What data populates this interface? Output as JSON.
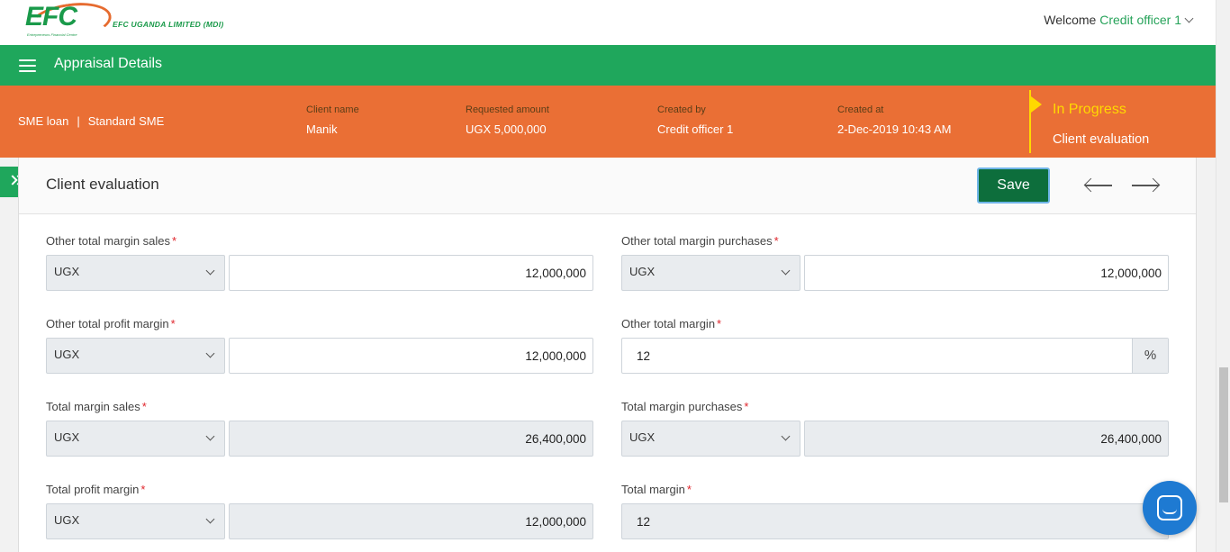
{
  "header": {
    "logo_text": "EFC",
    "logo_tagline": "Entrepreneurs Financial Centre",
    "company": "EFC UGANDA LIMITED (MDI)",
    "welcome_prefix": "Welcome",
    "user": "Credit officer 1"
  },
  "nav": {
    "title": "Appraisal Details"
  },
  "summary": {
    "loan_type": "SME loan",
    "separator": "|",
    "loan_subtype": "Standard SME",
    "client_name_label": "Client name",
    "client_name": "Manik",
    "requested_amount_label": "Requested amount",
    "requested_amount": "UGX 5,000,000",
    "created_by_label": "Created by",
    "created_by": "Credit officer 1",
    "created_at_label": "Created at",
    "created_at": "2-Dec-2019 10:43 AM",
    "status": "In Progress",
    "stage": "Client evaluation"
  },
  "section": {
    "title": "Client evaluation",
    "save_label": "Save"
  },
  "form": {
    "required_marker": "*",
    "other_total_margin_sales": {
      "label": "Other total margin sales",
      "currency": "UGX",
      "value": "12,000,000"
    },
    "other_total_margin_purchases": {
      "label": "Other total margin purchases",
      "currency": "UGX",
      "value": "12,000,000"
    },
    "other_total_profit_margin": {
      "label": "Other total profit margin",
      "currency": "UGX",
      "value": "12,000,000"
    },
    "other_total_margin": {
      "label": "Other total margin",
      "value": "12",
      "unit": "%"
    },
    "total_margin_sales": {
      "label": "Total margin sales",
      "currency": "UGX",
      "value": "26,400,000"
    },
    "total_margin_purchases": {
      "label": "Total margin purchases",
      "currency": "UGX",
      "value": "26,400,000"
    },
    "total_profit_margin": {
      "label": "Total profit margin",
      "currency": "UGX",
      "value": "12,000,000"
    },
    "total_margin": {
      "label": "Total margin",
      "value": "12"
    }
  },
  "colors": {
    "green": "#1fa75c",
    "orange": "#ea6f35",
    "status_yellow": "#ffd900",
    "save_green": "#0d6e3c",
    "chat_blue": "#1e7ad2"
  }
}
